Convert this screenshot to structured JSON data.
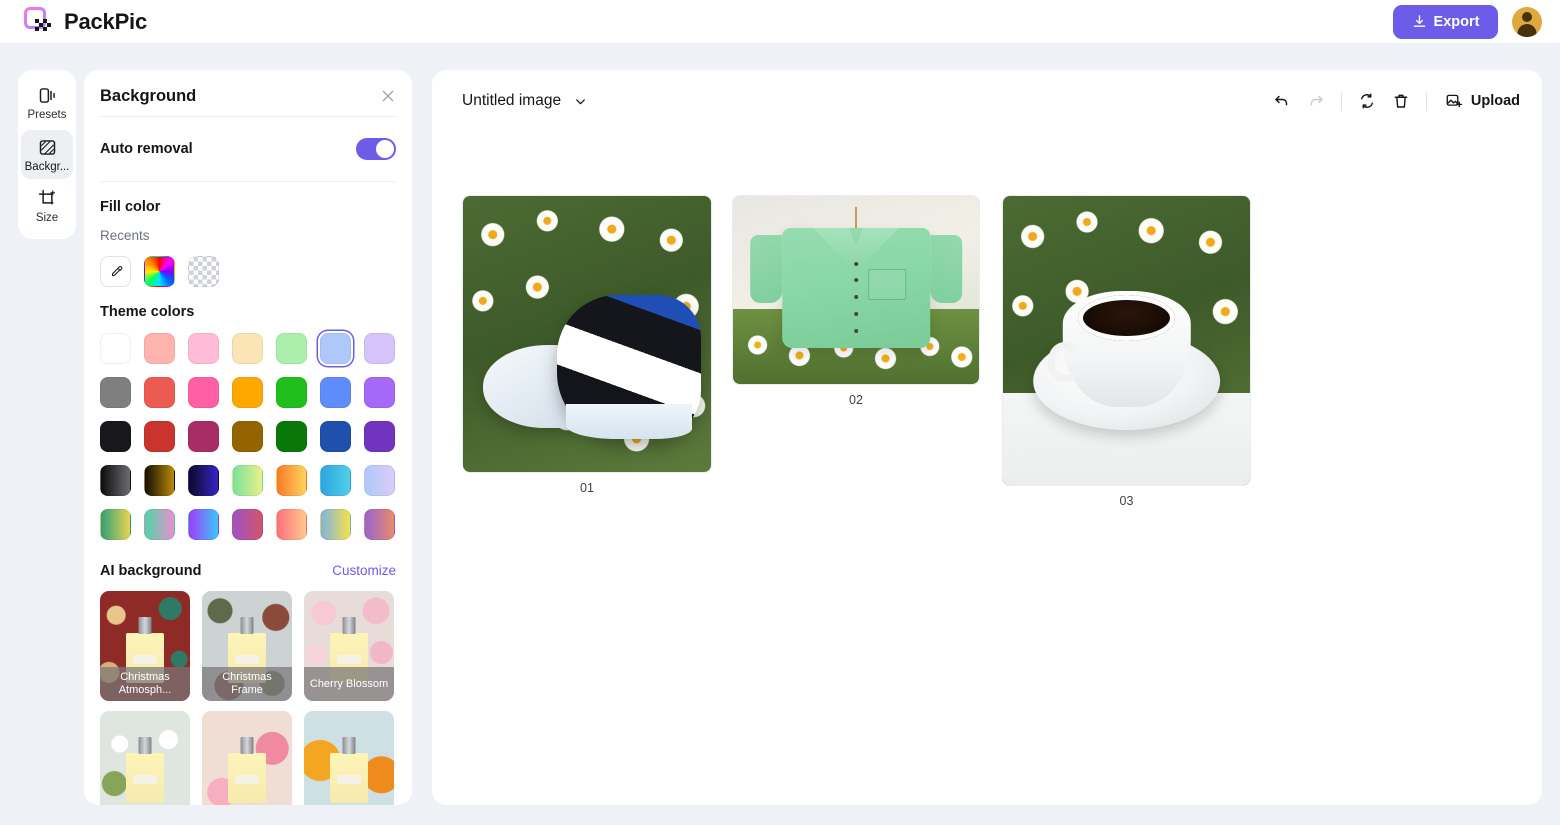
{
  "app": {
    "brand_name": "PackPic",
    "logo_icon": "packpic-logo-icon"
  },
  "topbar": {
    "export_label": "Export",
    "export_icon": "download-icon",
    "export_color": "#6c5ce7",
    "avatar_icon": "user-avatar-icon"
  },
  "rail": {
    "items": [
      {
        "label": "Presets",
        "icon": "presets-icon",
        "active": false
      },
      {
        "label": "Backgr...",
        "icon": "background-icon",
        "active": true
      },
      {
        "label": "Size",
        "icon": "crop-size-icon",
        "active": false
      }
    ]
  },
  "panel": {
    "title": "Background",
    "close_icon": "close-icon",
    "auto_removal": {
      "label": "Auto removal",
      "enabled": true,
      "toggle_color": "#6c5ce7"
    },
    "fill_color": {
      "title": "Fill color",
      "recents_label": "Recents",
      "recents": [
        {
          "name": "eyedropper-button",
          "type": "eyedropper",
          "icon": "eyedropper-icon"
        },
        {
          "name": "color-wheel-swatch",
          "type": "wheel"
        },
        {
          "name": "transparent-swatch",
          "type": "transparent"
        }
      ]
    },
    "theme_colors": {
      "title": "Theme colors",
      "rows": [
        [
          {
            "color": "#ffffff",
            "selected": false
          },
          {
            "color": "#ffb3ae",
            "selected": false
          },
          {
            "color": "#ffbcd8",
            "selected": false
          },
          {
            "color": "#fbe4b6",
            "selected": false
          },
          {
            "color": "#acefac",
            "selected": false
          },
          {
            "color": "#afc8fc",
            "selected": true
          },
          {
            "color": "#d6c3fa",
            "selected": false
          }
        ],
        [
          {
            "color": "#7f7f7f",
            "selected": false
          },
          {
            "color": "#ec5b52",
            "selected": false
          },
          {
            "color": "#ff5fa5",
            "selected": false
          },
          {
            "color": "#ffa800",
            "selected": false
          },
          {
            "color": "#20bf1c",
            "selected": false
          },
          {
            "color": "#5e8cfb",
            "selected": false
          },
          {
            "color": "#a569f7",
            "selected": false
          }
        ],
        [
          {
            "color": "#17171c",
            "selected": false
          },
          {
            "color": "#c9352e",
            "selected": false
          },
          {
            "color": "#a82d66",
            "selected": false
          },
          {
            "color": "#946400",
            "selected": false
          },
          {
            "color": "#097808",
            "selected": false
          },
          {
            "color": "#2050ad",
            "selected": false
          },
          {
            "color": "#7034be",
            "selected": false
          }
        ],
        [
          {
            "color": "linear-gradient(90deg,#0d0d0f,#6c6c70)",
            "selected": false
          },
          {
            "color": "linear-gradient(90deg,#120f05,#b98a06)",
            "selected": false
          },
          {
            "color": "linear-gradient(90deg,#0b0a28,#3723c4)",
            "selected": false
          },
          {
            "color": "linear-gradient(90deg,#77e29b,#eaf08a)",
            "selected": false
          },
          {
            "color": "linear-gradient(90deg,#f87a27,#ffd35e)",
            "selected": false
          },
          {
            "color": "linear-gradient(90deg,#2fa3e0,#4fd0e8)",
            "selected": false
          },
          {
            "color": "linear-gradient(90deg,#adc9fb,#ddccf7)",
            "selected": false
          }
        ],
        [
          {
            "color": "linear-gradient(90deg,#2fa07a,#e8d451)",
            "selected": false
          },
          {
            "color": "linear-gradient(90deg,#4dd6a6,#e98fd0)",
            "selected": false
          },
          {
            "color": "linear-gradient(90deg,#a13cf7,#3cc6fb)",
            "selected": false
          },
          {
            "color": "linear-gradient(90deg,#9c52c8,#d4556a)",
            "selected": false
          },
          {
            "color": "linear-gradient(90deg,#fb6f7f,#ffc98b)",
            "selected": false
          },
          {
            "color": "linear-gradient(90deg,#7fb3e3,#f4e24a)",
            "selected": false
          },
          {
            "color": "linear-gradient(90deg,#9765d0,#e98b6a)",
            "selected": false
          }
        ]
      ]
    },
    "ai_background": {
      "title": "AI background",
      "customize_label": "Customize",
      "customize_color": "#6c5ce7",
      "items": [
        {
          "label": "Christmas Atmosph...",
          "style": "bg-xmas",
          "show_caption": true
        },
        {
          "label": "Christmas Frame",
          "style": "bg-frame",
          "show_caption": true
        },
        {
          "label": "Cherry Blossom",
          "style": "bg-cherry",
          "show_caption": true
        },
        {
          "label": "",
          "style": "bg-daisy2",
          "show_caption": false
        },
        {
          "label": "",
          "style": "bg-pinkflower",
          "show_caption": false
        },
        {
          "label": "",
          "style": "bg-sunflower",
          "show_caption": false
        }
      ]
    }
  },
  "canvas": {
    "document_title": "Untitled image",
    "dropdown_icon": "chevron-down-icon",
    "tools": [
      {
        "name": "undo-button",
        "icon": "undo-icon",
        "disabled": false
      },
      {
        "name": "redo-button",
        "icon": "redo-icon",
        "disabled": true
      },
      {
        "name": "reset-button",
        "icon": "refresh-icon",
        "disabled": false
      },
      {
        "name": "delete-button",
        "icon": "trash-icon",
        "disabled": false
      }
    ],
    "upload": {
      "label": "Upload",
      "icon": "add-image-icon"
    },
    "images": [
      {
        "caption": "01",
        "subject": "sneakers-on-daisy-field"
      },
      {
        "caption": "02",
        "subject": "green-shirt-on-hanger"
      },
      {
        "caption": "03",
        "subject": "coffee-cup-on-daisy-field"
      }
    ]
  }
}
